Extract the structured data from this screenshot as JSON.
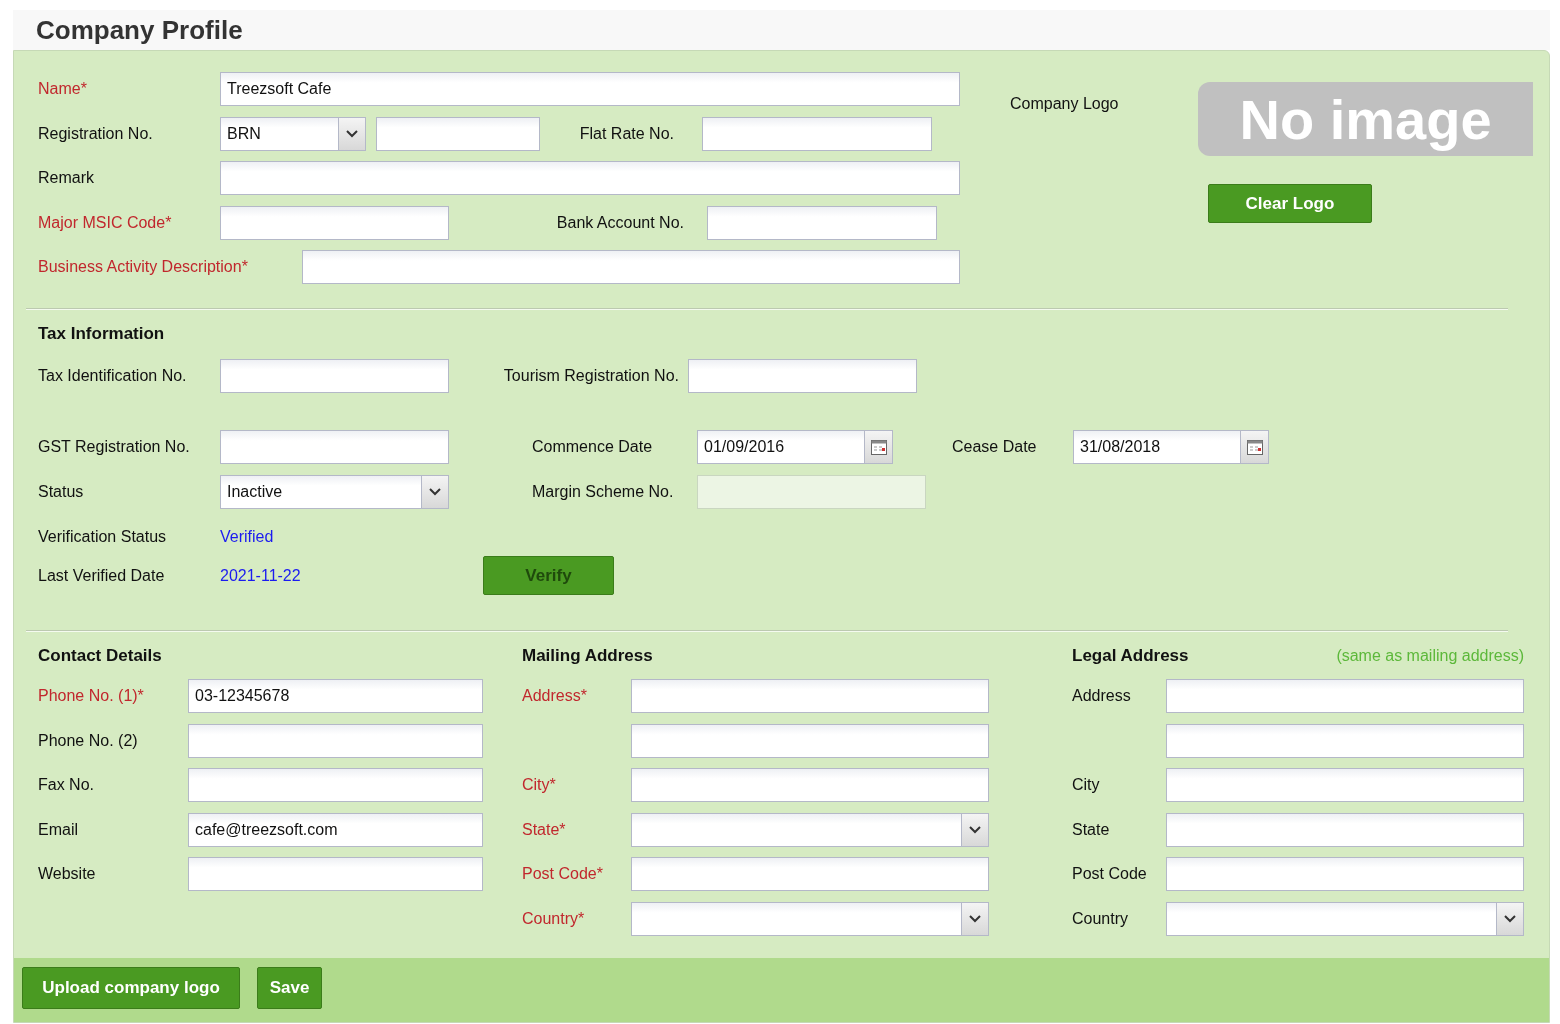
{
  "title": "Company Profile",
  "general": {
    "rows": [
      [
        {
          "label": "Name*",
          "required": true,
          "kind": "text",
          "value": "Treezsoft Cafe"
        }
      ],
      [
        {
          "label": "Registration No.",
          "required": false,
          "kind": "select",
          "value": "BRN"
        },
        {
          "kind": "text"
        },
        {
          "label": "Flat Rate No.",
          "required": false,
          "kind": "text"
        }
      ],
      [
        {
          "label": "Remark",
          "required": false,
          "kind": "text"
        }
      ],
      [
        {
          "label": "Major MSIC Code*",
          "required": true,
          "kind": "text"
        },
        {
          "label": "Bank Account No.",
          "required": false,
          "kind": "text"
        }
      ],
      [
        {
          "label": "Business Activity Description*",
          "required": true,
          "kind": "text"
        }
      ]
    ],
    "logo": {
      "label": "Company Logo",
      "placeholder_text": "No image",
      "button": "Clear Logo"
    }
  },
  "tax": {
    "heading": "Tax Information",
    "rows": [
      [
        {
          "label": "Tax Identification No.",
          "required": false,
          "kind": "text",
          "disabled": false
        },
        {
          "label": "Tourism Registration No.",
          "required": false,
          "kind": "text",
          "disabled": false
        }
      ],
      [
        {
          "label": "GST Registration No.",
          "required": false,
          "kind": "text",
          "disabled": false
        },
        {
          "label": "Commence Date",
          "required": false,
          "kind": "date",
          "value": "01/09/2016",
          "disabled": false
        },
        {
          "label": "Cease Date",
          "required": false,
          "kind": "date",
          "value": "31/08/2018",
          "disabled": false
        }
      ],
      [
        {
          "label": "Status",
          "required": false,
          "kind": "select",
          "value": "Inactive",
          "disabled": false
        },
        {
          "label": "Margin Scheme No.",
          "required": false,
          "kind": "text",
          "disabled": true
        }
      ]
    ],
    "verification": [
      {
        "label": "Verification Status",
        "value": "Verified"
      },
      {
        "label": "Last Verified Date",
        "value": "2021-11-22"
      }
    ],
    "verify_button": {
      "label": "Verify",
      "disabled": true
    }
  },
  "contact": {
    "heading": "Contact Details",
    "fields": [
      {
        "label": "Phone No. (1)*",
        "required": true,
        "kind": "text",
        "value": "03-12345678"
      },
      {
        "label": "Phone No. (2)",
        "required": false,
        "kind": "text"
      },
      {
        "label": "Fax No.",
        "required": false,
        "kind": "text"
      },
      {
        "label": "Email",
        "required": false,
        "kind": "text",
        "value": "cafe@treezsoft.com"
      },
      {
        "label": "Website",
        "required": false,
        "kind": "text"
      }
    ]
  },
  "mailing": {
    "heading": "Mailing Address",
    "fields": [
      {
        "label": "Address*",
        "required": true,
        "kind": "text"
      },
      {
        "kind": "text"
      },
      {
        "label": "City*",
        "required": true,
        "kind": "text"
      },
      {
        "label": "State*",
        "required": true,
        "kind": "select"
      },
      {
        "label": "Post Code*",
        "required": true,
        "kind": "text"
      },
      {
        "label": "Country*",
        "required": true,
        "kind": "select"
      }
    ]
  },
  "legal": {
    "heading": "Legal Address",
    "note": "(same as mailing address)",
    "fields": [
      {
        "label": "Address",
        "required": false,
        "kind": "text"
      },
      {
        "kind": "text"
      },
      {
        "label": "City",
        "required": false,
        "kind": "text"
      },
      {
        "label": "State",
        "required": false,
        "kind": "text"
      },
      {
        "label": "Post Code",
        "required": false,
        "kind": "text"
      },
      {
        "label": "Country",
        "required": false,
        "kind": "select"
      }
    ]
  },
  "footer_buttons": [
    {
      "label": "Upload company logo"
    },
    {
      "label": "Save"
    }
  ]
}
